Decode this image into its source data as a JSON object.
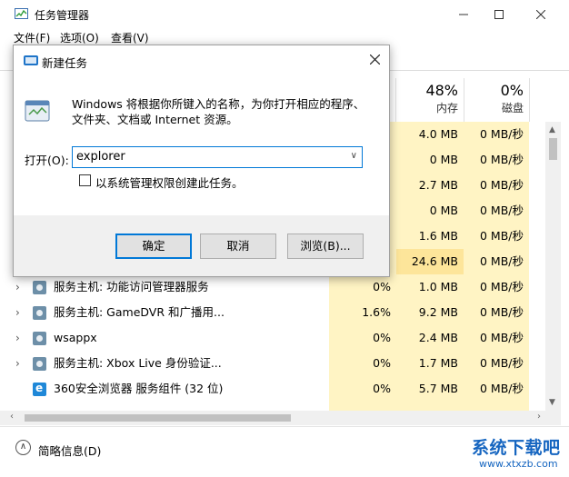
{
  "taskmgr": {
    "title": "任务管理器",
    "menu": [
      "文件(F)",
      "选项(O)",
      "查看(V)"
    ],
    "columns": {
      "memory": {
        "percent": "48%",
        "label": "内存"
      },
      "disk": {
        "percent": "0%",
        "label": "磁盘"
      }
    },
    "partial_rows": [
      {
        "mem": "4.0 MB",
        "disk": "0 MB/秒"
      },
      {
        "mem": "0 MB",
        "disk": "0 MB/秒"
      },
      {
        "mem": "2.7 MB",
        "disk": "0 MB/秒"
      },
      {
        "mem": "0 MB",
        "disk": "0 MB/秒"
      },
      {
        "mem": "1.6 MB",
        "disk": "0 MB/秒"
      },
      {
        "mem": "24.6 MB",
        "disk": "0 MB/秒"
      }
    ],
    "rows": [
      {
        "name": "服务主机: 功能访问管理器服务",
        "cpu": "0%",
        "mem": "1.0 MB",
        "disk": "0 MB/秒",
        "icon": "gear-icon"
      },
      {
        "name": "服务主机: GameDVR 和广播用...",
        "cpu": "1.6%",
        "mem": "9.2 MB",
        "disk": "0 MB/秒",
        "icon": "gear-icon"
      },
      {
        "name": "wsappx",
        "cpu": "0%",
        "mem": "2.4 MB",
        "disk": "0 MB/秒",
        "icon": "gear-icon"
      },
      {
        "name": "服务主机: Xbox Live 身份验证...",
        "cpu": "0%",
        "mem": "1.7 MB",
        "disk": "0 MB/秒",
        "icon": "gear-icon"
      },
      {
        "name": "360安全浏览器 服务组件 (32 位)",
        "cpu": "0%",
        "mem": "5.7 MB",
        "disk": "0 MB/秒",
        "icon": "browser-360-icon"
      }
    ],
    "footer_label": "简略信息(D)"
  },
  "run_dialog": {
    "title": "新建任务",
    "description": "Windows 将根据你所键入的名称，为你打开相应的程序、文件夹、文档或 Internet 资源。",
    "open_label": "打开(O):",
    "input_value": "explorer",
    "admin_checkbox_label": "以系统管理权限创建此任务。",
    "admin_checked": false,
    "ok_label": "确定",
    "cancel_label": "取消",
    "browse_label": "浏览(B)..."
  },
  "watermark": {
    "main": "系统下载吧",
    "sub": "www.xtxzb.com"
  }
}
